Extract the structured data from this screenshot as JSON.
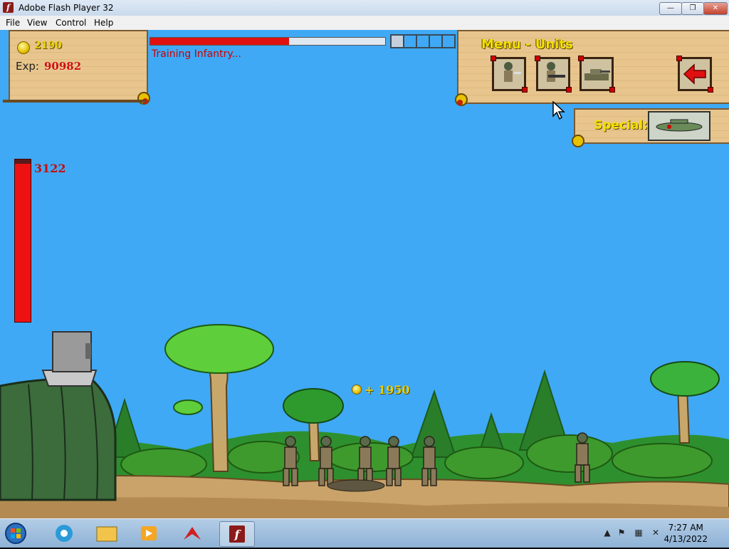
{
  "window": {
    "title": "Adobe Flash Player 32",
    "app_icon": "f",
    "minimize": "—",
    "maximize": "❐",
    "close": "✕"
  },
  "menu": {
    "items": [
      "File",
      "View",
      "Control",
      "Help"
    ]
  },
  "hud": {
    "gold": "2190",
    "exp_label": "Exp:",
    "exp_value": "90982",
    "training_text": "Training Infantry...",
    "training_progress": 0.59,
    "queue_slots": 5,
    "queue_filled": 1
  },
  "units_menu": {
    "title": "Menu - Units",
    "units": [
      {
        "name": "Infantry",
        "icon": "infantry-knife-icon"
      },
      {
        "name": "Machine Gunner",
        "icon": "machine-gunner-icon"
      },
      {
        "name": "Tank",
        "icon": "tank-icon"
      }
    ],
    "back_icon": "red-arrow-left-icon",
    "special_label": "Special:",
    "special_icon": "airstrike-plane-icon"
  },
  "base": {
    "health": "3122",
    "health_fraction": 1.0
  },
  "battlefield": {
    "gold_gain": "+ 1950"
  },
  "taskbar": {
    "time": "7:27 AM",
    "date": "4/13/2022",
    "apps": [
      "start-orb-icon",
      "chrome-icon",
      "explorer-folder-icon",
      "media-player-icon",
      "adobe-acrobat-icon",
      "flash-player-icon"
    ]
  },
  "colors": {
    "sky": "#3fa9f5",
    "gold_text": "#e8d000",
    "exp_red": "#d01010",
    "hp_red": "#ee1111"
  }
}
